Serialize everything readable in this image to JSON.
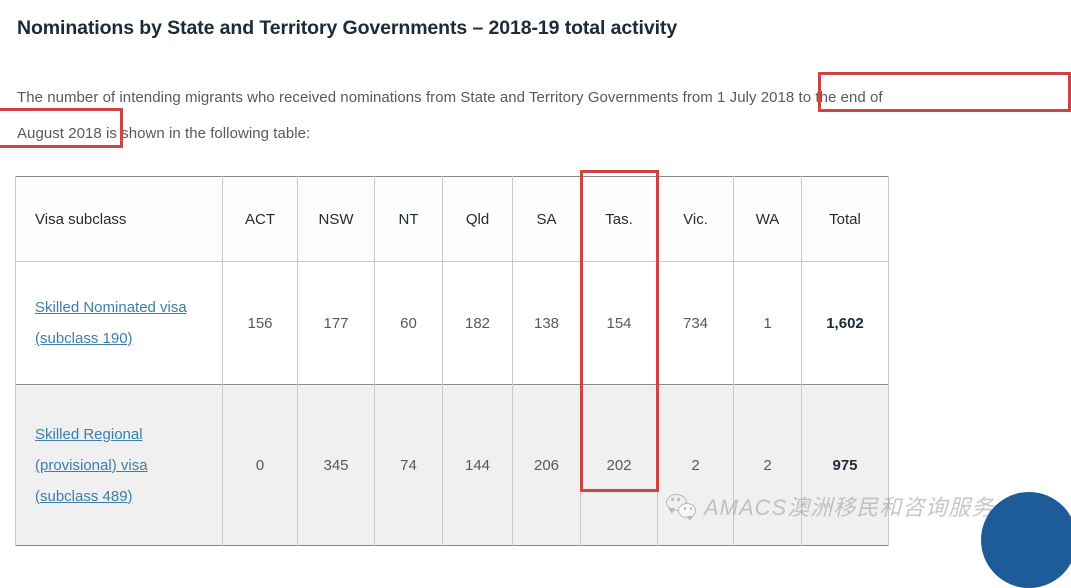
{
  "page": {
    "title": "Nominations by State and Territory Governments – 2018-19 total activity",
    "intro_line1": "The number of intending migrants who received nominations from State and Territory Governments from 1 July 2018 to the end of",
    "intro_line2": "August 2018 is shown in the following table:"
  },
  "table": {
    "headers": [
      "Visa subclass",
      "ACT",
      "NSW",
      "NT",
      "Qld",
      "SA",
      "Tas.",
      "Vic.",
      "WA",
      "Total"
    ],
    "rows": [
      {
        "label": "Skilled Nominated visa (subclass 190)",
        "act": "156",
        "nsw": "177",
        "nt": "60",
        "qld": "182",
        "sa": "138",
        "tas": "154",
        "vic": "734",
        "wa": "1",
        "total": "1,602"
      },
      {
        "label": "Skilled Regional (provisional) visa (subclass 489)",
        "act": "0",
        "nsw": "345",
        "nt": "74",
        "qld": "144",
        "sa": "206",
        "tas": "202",
        "vic": "2",
        "wa": "2",
        "total": "975"
      }
    ]
  },
  "annotations": {
    "color": "#cf4344",
    "box_date_range_label": "from 1 July 2018 to the end of",
    "box_month_label": "August 2018",
    "box_column_label": "Tas."
  },
  "watermark": {
    "text": "AMACS澳洲移民和咨询服务",
    "icon": "wechat-icon",
    "color": "#9a9a9a"
  },
  "decor": {
    "blob_color": "#1d5c99"
  }
}
